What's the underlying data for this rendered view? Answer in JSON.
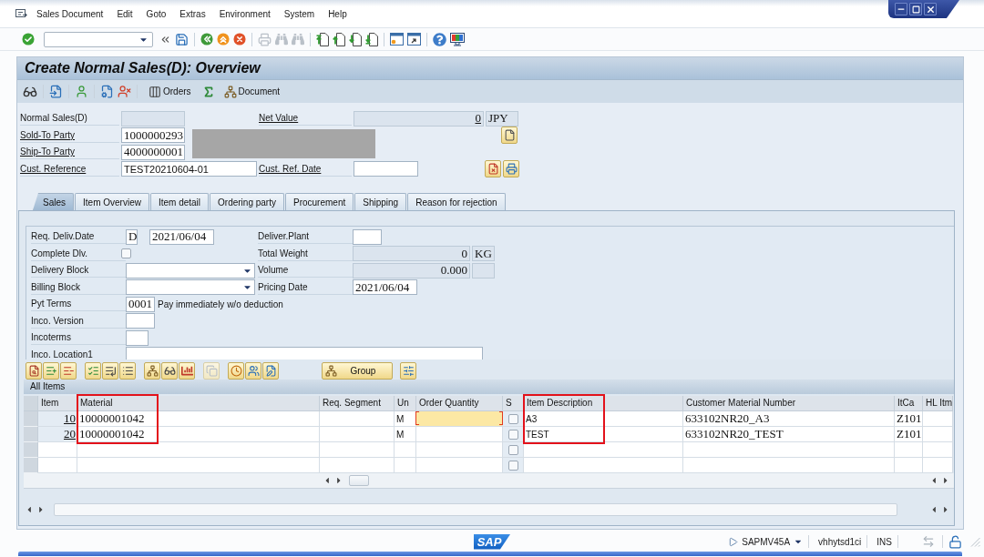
{
  "menu_bar": {
    "items": [
      "Sales Document",
      "Edit",
      "Goto",
      "Extras",
      "Environment",
      "System",
      "Help"
    ]
  },
  "toolbar": {
    "buttons": [
      {
        "disabled": false
      },
      {
        "disabled": false
      },
      {
        "disabled": false
      },
      {
        "disabled": false
      },
      {
        "disabled": false
      },
      {
        "disabled": false
      },
      {
        "disabled": true
      },
      {
        "disabled": true
      },
      {
        "disabled": true
      },
      {
        "disabled": false
      },
      {
        "disabled": false
      },
      {
        "disabled": false
      },
      {
        "disabled": false
      },
      {
        "disabled": false
      },
      {
        "disabled": false
      },
      {
        "disabled": false
      },
      {
        "disabled": false
      }
    ]
  },
  "title": "Create Normal Sales(D): Overview",
  "app_toolbar": {
    "orders_button": "Orders",
    "document_button": "Document"
  },
  "header": {
    "doc_type": {
      "label": "Normal Sales(D)"
    },
    "net_value": {
      "label": "Net Value",
      "value": "0",
      "currency": "JPY"
    },
    "sold_to": {
      "label": "Sold-To Party",
      "value": "1000000293"
    },
    "ship_to": {
      "label": "Ship-To Party",
      "value": "4000000001"
    },
    "cust_reference": {
      "label": "Cust. Reference",
      "value": "TEST20210604-01"
    },
    "cust_ref_date": {
      "label": "Cust. Ref. Date"
    }
  },
  "tabs": [
    {
      "label": "Sales",
      "selected": true
    },
    {
      "label": "Item Overview",
      "selected": false
    },
    {
      "label": "Item detail",
      "selected": false
    },
    {
      "label": "Ordering party",
      "selected": false
    },
    {
      "label": "Procurement",
      "selected": false
    },
    {
      "label": "Shipping",
      "selected": false
    },
    {
      "label": "Reason for rejection",
      "selected": false
    }
  ],
  "sales": {
    "left": [
      {
        "kind": "date",
        "label": "Req. Deliv.Date",
        "prefix": "D",
        "value": "2021/06/04"
      },
      {
        "kind": "checkbox",
        "label": "Complete Dlv.",
        "checked": false
      },
      {
        "kind": "dropdown",
        "label": "Delivery Block"
      },
      {
        "kind": "dropdown",
        "label": "Billing Block"
      },
      {
        "kind": "code",
        "label": "Pyt Terms",
        "value": "0001",
        "note": "Pay immediately w/o deduction"
      },
      {
        "kind": "short",
        "label": "Inco. Version"
      },
      {
        "kind": "tiny",
        "label": "Incoterms"
      },
      {
        "kind": "long",
        "label": "Inco. Location1"
      }
    ],
    "right": [
      {
        "kind": "short",
        "label": "Deliver.Plant"
      },
      {
        "kind": "measure",
        "label": "Total Weight",
        "value": "0",
        "unit": "KG"
      },
      {
        "kind": "measure",
        "label": "Volume",
        "value": "0.000"
      },
      {
        "kind": "date",
        "label": "Pricing Date",
        "value": "2021/06/04"
      }
    ]
  },
  "items": {
    "toolbar": {
      "buttons": [
        {
          "disabled": false
        },
        {
          "disabled": false
        },
        {
          "disabled": false
        },
        {
          "disabled": false
        },
        {
          "disabled": false
        },
        {
          "disabled": false
        },
        {
          "disabled": false
        },
        {
          "disabled": false
        },
        {
          "disabled": false
        },
        {
          "disabled": true
        },
        {
          "disabled": false
        },
        {
          "disabled": false
        },
        {
          "disabled": false
        },
        {
          "disabled": false
        }
      ],
      "group_button": "Group"
    },
    "title": "All Items",
    "columns": [
      {
        "label": "Item",
        "highlighted": false
      },
      {
        "label": "Material",
        "highlighted": true
      },
      {
        "label": "Req. Segment",
        "highlighted": false
      },
      {
        "label": "Un",
        "highlighted": false
      },
      {
        "label": "Order Quantity",
        "highlighted": false
      },
      {
        "label": "S",
        "highlighted": false
      },
      {
        "label": "Item Description",
        "highlighted": true
      },
      {
        "label": "Customer Material Number",
        "highlighted": false
      },
      {
        "label": "ItCa",
        "highlighted": false
      },
      {
        "label": "HL Itm",
        "highlighted": false
      }
    ],
    "rows": [
      {
        "item": "10",
        "material": "10000001042",
        "unit": "M",
        "focused": true,
        "checked": false,
        "description": "A3",
        "customer_material": "633102NR20_A3",
        "itca": "Z101"
      },
      {
        "item": "20",
        "material": "10000001042",
        "unit": "M",
        "focused": false,
        "checked": false,
        "description": "TEST",
        "customer_material": "633102NR20_TEST",
        "itca": "Z101"
      },
      {
        "focused": false,
        "checked": false
      },
      {
        "focused": false,
        "checked": false
      }
    ]
  },
  "status_bar": {
    "logo": "SAP",
    "program": "SAPMV45A",
    "server": "vhhytsd1ci",
    "mode": "INS"
  }
}
